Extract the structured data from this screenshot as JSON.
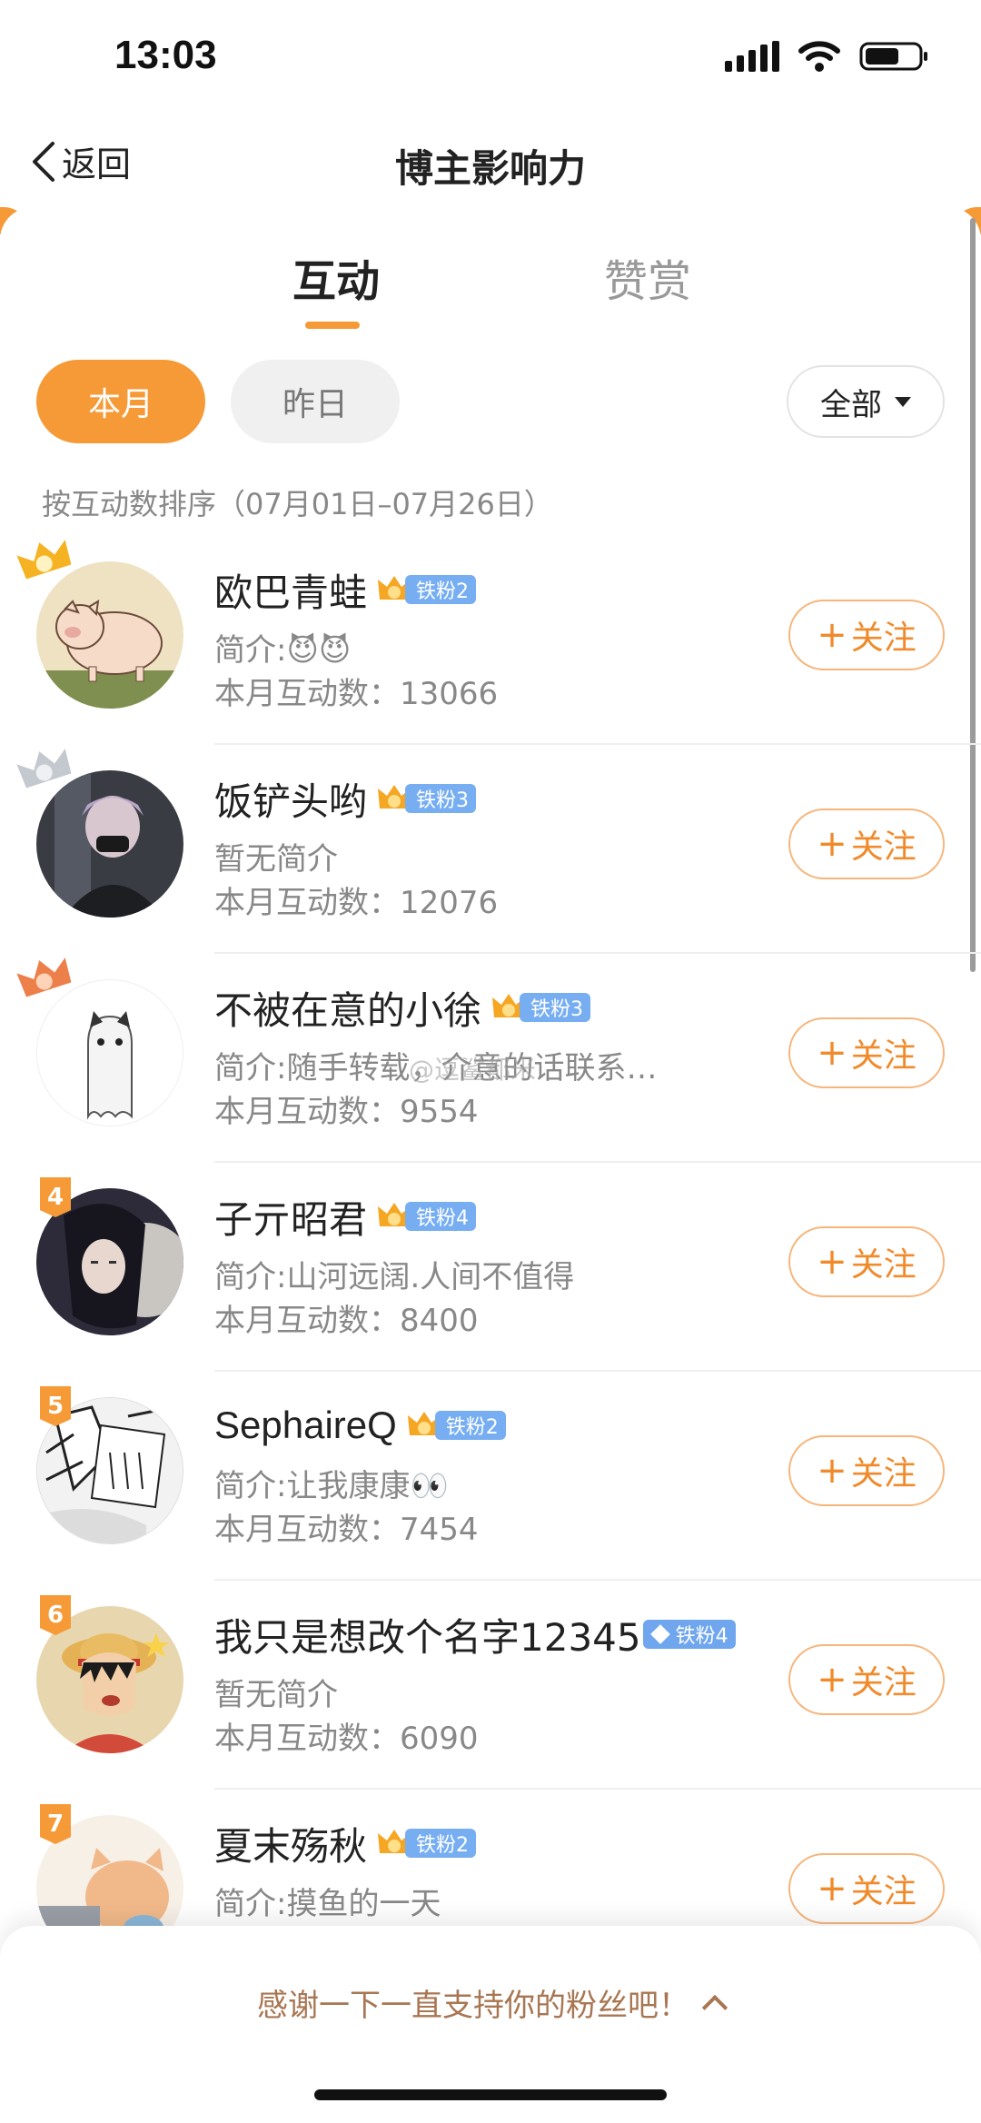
{
  "status_bar": {
    "time": "13:03"
  },
  "nav": {
    "back_label": "返回",
    "title": "博主影响力"
  },
  "tabs": [
    {
      "label": "互动",
      "active": true
    },
    {
      "label": "赞赏",
      "active": false
    }
  ],
  "filters": {
    "this_month": "本月",
    "yesterday": "昨日",
    "dropdown": "全部"
  },
  "sort_note": "按互动数排序（07月01日–07月26日）",
  "follow_label": "关注",
  "items": [
    {
      "rank": "1",
      "name": "欧巴青蛙",
      "fan_level": "铁粉2",
      "bio": "简介:😈😈",
      "count": "本月互动数：13066"
    },
    {
      "rank": "2",
      "name": "饭铲头哟",
      "fan_level": "铁粉3",
      "bio": "暂无简介",
      "count": "本月互动数：12076"
    },
    {
      "rank": "3",
      "name": "不被在意的小徐",
      "fan_level": "铁粉3",
      "bio": "简介:随手转载，介意的话联系…",
      "count": "本月互动数：9554"
    },
    {
      "rank": "4",
      "name": "子亓昭君",
      "fan_level": "铁粉4",
      "bio": "简介:山河远阔.人间不值得",
      "count": "本月互动数：8400"
    },
    {
      "rank": "5",
      "name": "SephaireQ",
      "fan_level": "铁粉2",
      "bio": "简介:让我康康👀",
      "count": "本月互动数：7454"
    },
    {
      "rank": "6",
      "name": "我只是想改个名字12345",
      "fan_level": "铁粉4",
      "bio": "暂无简介",
      "count": "本月互动数：6090"
    },
    {
      "rank": "7",
      "name": "夏末殇秋",
      "fan_level": "铁粉2",
      "bio": "简介:摸鱼的一天",
      "count": ""
    }
  ],
  "watermark": "@逗鲨都米",
  "bottom_sheet": {
    "thanks": "感谢一下一直支持你的粉丝吧！"
  },
  "colors": {
    "accent": "#f59a36",
    "fan_badge": "#77aef2",
    "follow_text": "#f08a2a"
  }
}
